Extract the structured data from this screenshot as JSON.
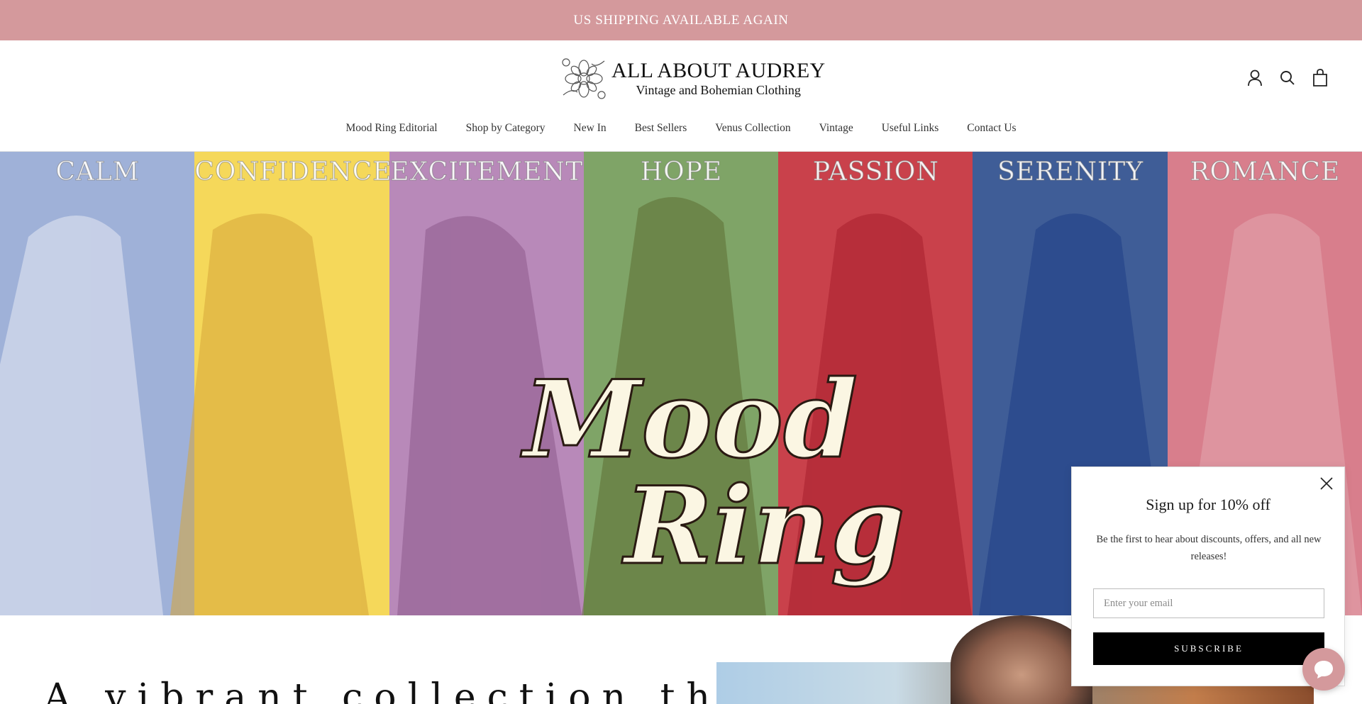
{
  "announcement": {
    "text": "US SHIPPING AVAILABLE AGAIN"
  },
  "brand": {
    "title": "ALL ABOUT AUDREY",
    "subtitle": "Vintage and Bohemian Clothing"
  },
  "header_icons": [
    "account-icon",
    "search-icon",
    "cart-icon"
  ],
  "nav": {
    "items": [
      "Mood Ring Editorial",
      "Shop by Category",
      "New In",
      "Best Sellers",
      "Venus Collection",
      "Vintage",
      "Useful Links",
      "Contact Us"
    ]
  },
  "hero": {
    "panels": [
      {
        "label": "CALM",
        "color": "#9fb1d8"
      },
      {
        "label": "CONFIDENCE",
        "color": "#f5d85a"
      },
      {
        "label": "EXCITEMENT",
        "color": "#b889b9"
      },
      {
        "label": "HOPE",
        "color": "#7fa467"
      },
      {
        "label": "PASSION",
        "color": "#c9414b"
      },
      {
        "label": "SERENITY",
        "color": "#3f5d97"
      },
      {
        "label": "ROMANCE",
        "color": "#d87e8c"
      }
    ],
    "title_line1": "Mood",
    "title_line2": "Ring"
  },
  "below": {
    "tagline": "A vibrant collection that"
  },
  "popup": {
    "title": "Sign up for 10% off",
    "text": "Be the first to hear about discounts, offers, and all new releases!",
    "email_placeholder": "Enter your email",
    "button_label": "SUBSCRIBE"
  },
  "colors": {
    "announcement_bg": "#d4999c",
    "button_bg": "#000000",
    "chat_bg": "#d4999c"
  }
}
